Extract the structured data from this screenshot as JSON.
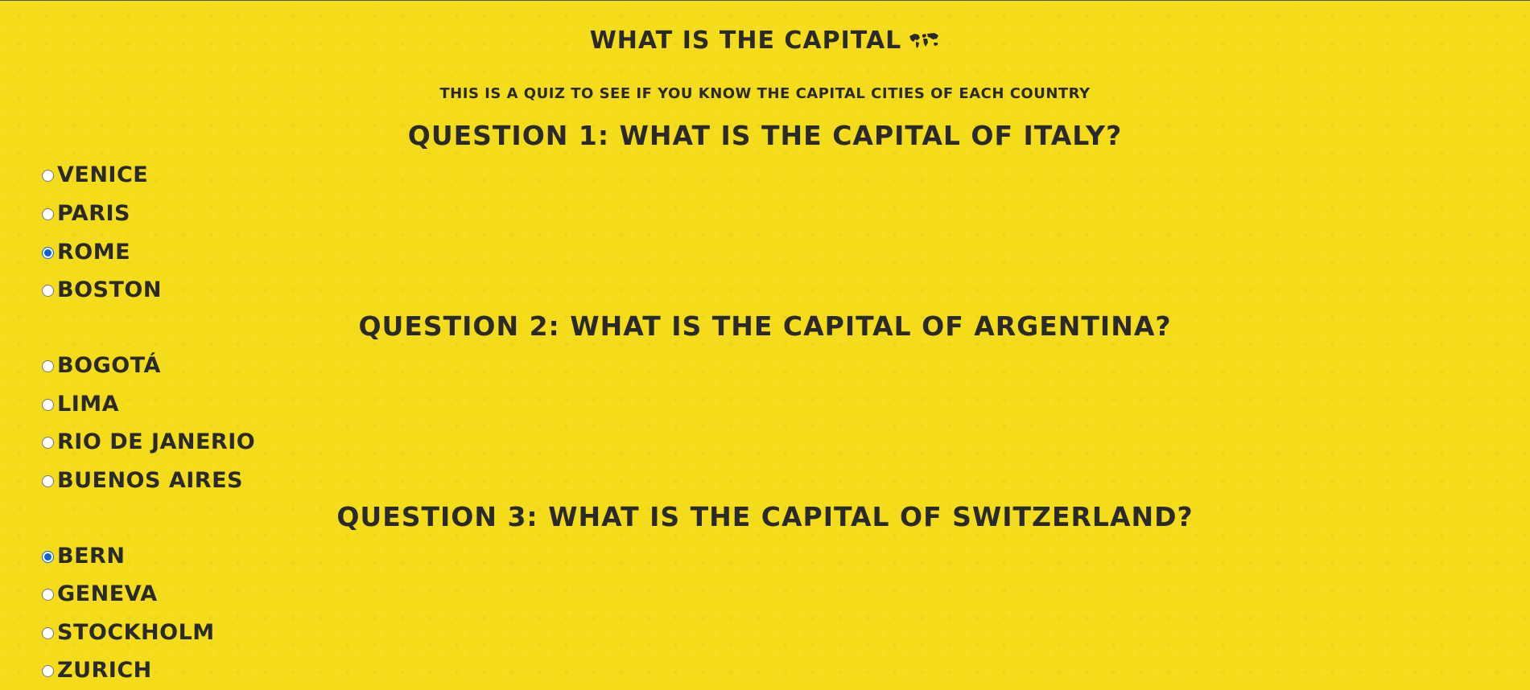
{
  "header": {
    "title": "What is the capital",
    "subtitle": "This is a quiz to see if you know the capital cities of each country"
  },
  "questions": [
    {
      "text": "Question 1: What is the capital of Italy?",
      "options": [
        {
          "label": "Venice",
          "checked": false
        },
        {
          "label": "Paris",
          "checked": false
        },
        {
          "label": "Rome",
          "checked": true
        },
        {
          "label": "Boston",
          "checked": false
        }
      ]
    },
    {
      "text": "Question 2: What is the capital of Argentina?",
      "options": [
        {
          "label": "Bogotá",
          "checked": false
        },
        {
          "label": "Lima",
          "checked": false
        },
        {
          "label": "Rio de Janerio",
          "checked": false
        },
        {
          "label": "Buenos Aires",
          "checked": false
        }
      ]
    },
    {
      "text": "Question 3: What is the capital of Switzerland?",
      "options": [
        {
          "label": "Bern",
          "checked": true
        },
        {
          "label": "Geneva",
          "checked": false
        },
        {
          "label": "Stockholm",
          "checked": false
        },
        {
          "label": "Zurich",
          "checked": false
        }
      ]
    }
  ],
  "colors": {
    "background": "#f5dc1a",
    "text": "#2a2a2a",
    "radio_checked": "#0b63d6"
  },
  "icons": {
    "title_icon": "world-map-icon"
  }
}
